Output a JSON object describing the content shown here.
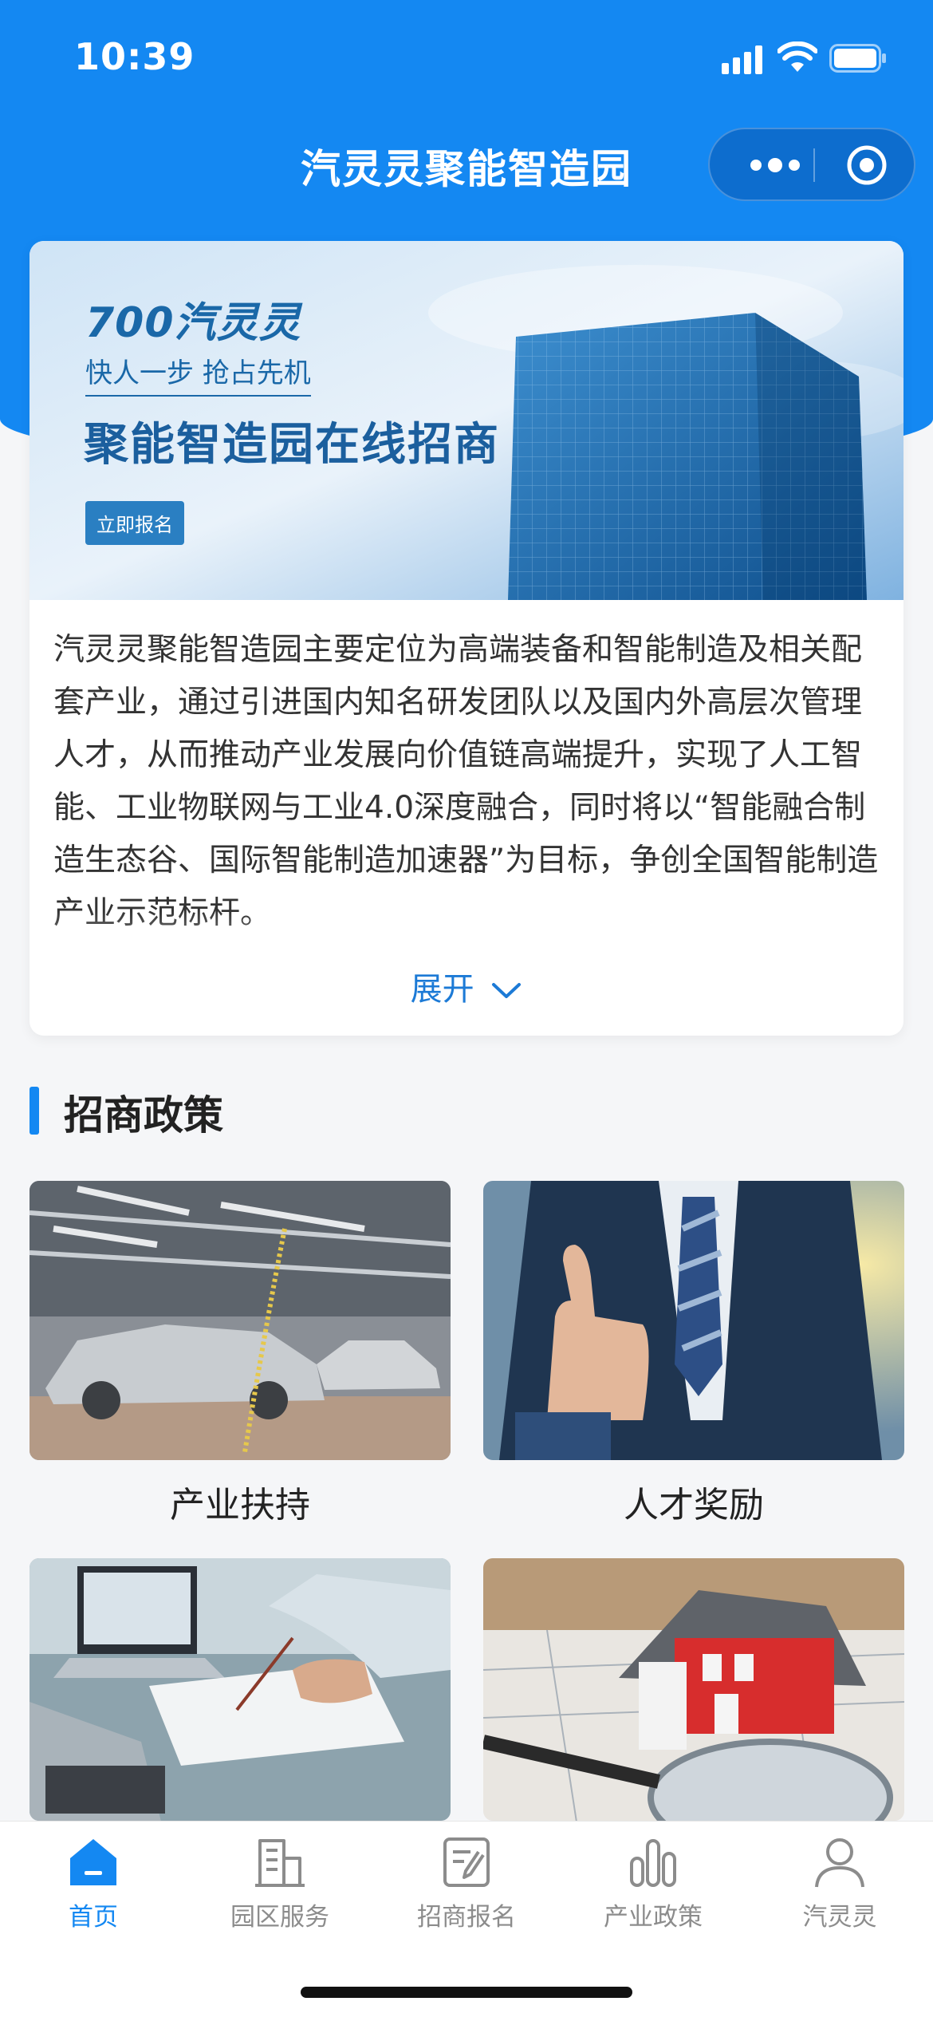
{
  "status_bar": {
    "time": "10:39"
  },
  "nav": {
    "title": "汽灵灵聚能智造园"
  },
  "banner": {
    "brand": "700汽灵灵",
    "slogan": "快人一步  抢占先机",
    "headline": "聚能智造园在线招商",
    "cta_label": "立即报名"
  },
  "intro": {
    "text": "汽灵灵聚能智造园主要定位为高端装备和智能制造及相关配套产业，通过引进国内知名研发团队以及国内外高层次管理人才，从而推动产业发展向价值链高端提升，实现了人工智能、工业物联网与工业4.0深度融合，同时将以“智能融合制造生态谷、国际智能制造加速器”为目标，争创全国智能制造产业示范标杆。",
    "expand_label": "展开"
  },
  "section": {
    "title": "招商政策"
  },
  "policies": [
    {
      "label": "产业扶持"
    },
    {
      "label": "人才奖励"
    },
    {
      "label": ""
    },
    {
      "label": ""
    }
  ],
  "tabs": [
    {
      "label": "首页",
      "icon": "home-icon",
      "active": true
    },
    {
      "label": "园区服务",
      "icon": "building-icon",
      "active": false
    },
    {
      "label": "招商报名",
      "icon": "edit-form-icon",
      "active": false
    },
    {
      "label": "产业政策",
      "icon": "bar-chart-icon",
      "active": false
    },
    {
      "label": "汽灵灵",
      "icon": "user-icon",
      "active": false
    }
  ],
  "colors": {
    "primary": "#1488f2",
    "tab_inactive": "#8c8c8c"
  }
}
